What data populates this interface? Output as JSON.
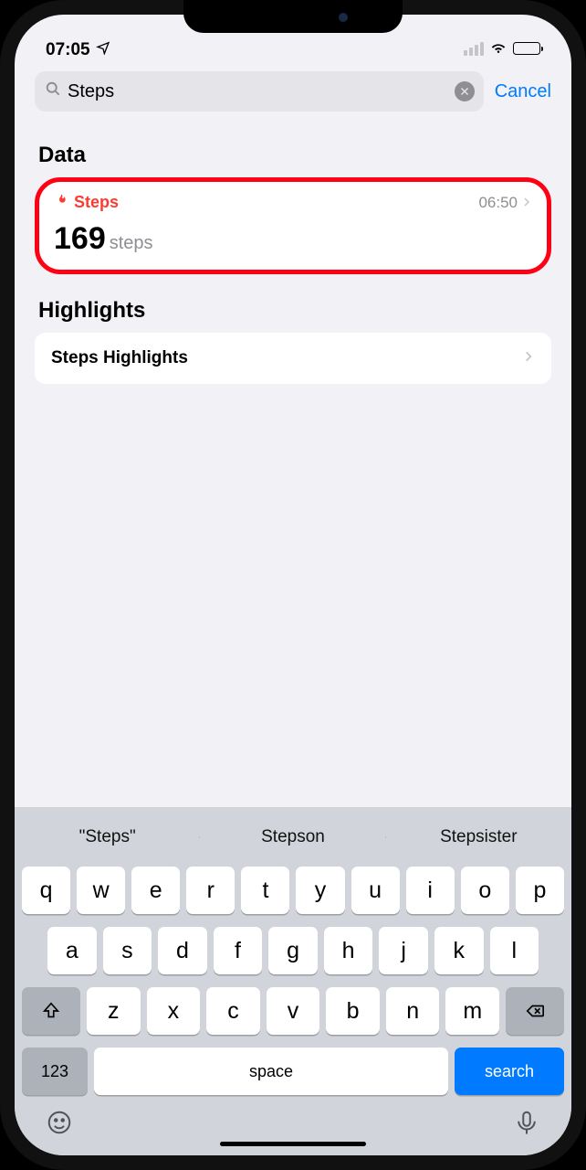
{
  "status": {
    "time": "07:05"
  },
  "search": {
    "value": "Steps",
    "cancel": "Cancel"
  },
  "sections": {
    "data": {
      "title": "Data",
      "card": {
        "title": "Steps",
        "time": "06:50",
        "value": "169",
        "unit": "steps"
      }
    },
    "highlights": {
      "title": "Highlights",
      "row": "Steps Highlights"
    }
  },
  "keyboard": {
    "suggestions": [
      "\"Steps\"",
      "Stepson",
      "Stepsister"
    ],
    "row1": [
      "q",
      "w",
      "e",
      "r",
      "t",
      "y",
      "u",
      "i",
      "o",
      "p"
    ],
    "row2": [
      "a",
      "s",
      "d",
      "f",
      "g",
      "h",
      "j",
      "k",
      "l"
    ],
    "row3": [
      "z",
      "x",
      "c",
      "v",
      "b",
      "n",
      "m"
    ],
    "numKey": "123",
    "space": "space",
    "search": "search"
  }
}
